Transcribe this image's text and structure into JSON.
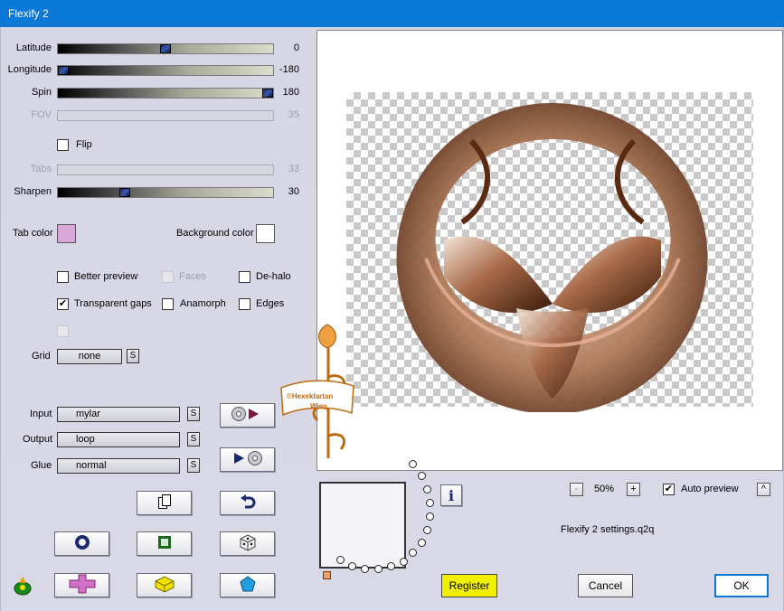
{
  "window": {
    "title": "Flexify 2"
  },
  "sliders": [
    {
      "label": "Latitude",
      "value": "0",
      "position": 0.5,
      "enabled": true
    },
    {
      "label": "Longitude",
      "value": "-180",
      "position": 0.0,
      "enabled": true
    },
    {
      "label": "Spin",
      "value": "180",
      "position": 1.0,
      "enabled": true
    },
    {
      "label": "FOV",
      "value": "35",
      "position": 0,
      "enabled": false
    },
    {
      "label": "Tabs",
      "value": "33",
      "position": 0,
      "enabled": false
    },
    {
      "label": "Sharpen",
      "value": "30",
      "position": 0.3,
      "enabled": true
    }
  ],
  "flip": {
    "label": "Flip",
    "checked": false
  },
  "colors": {
    "tab_label": "Tab color",
    "tab_value": "#d9a8d8",
    "bg_label": "Background color",
    "bg_value": "#ffffff"
  },
  "options": {
    "better_preview": {
      "label": "Better preview",
      "checked": false
    },
    "faces": {
      "label": "Faces",
      "checked": false,
      "enabled": false
    },
    "dehalo": {
      "label": "De-halo",
      "checked": false
    },
    "transparent_gaps": {
      "label": "Transparent gaps",
      "checked": true
    },
    "anamorph": {
      "label": "Anamorph",
      "checked": false
    },
    "edges": {
      "label": "Edges",
      "checked": false
    }
  },
  "grid": {
    "label": "Grid",
    "value": "none",
    "s": "S"
  },
  "projection": {
    "input_label": "Input",
    "input_value": "mylar",
    "output_label": "Output",
    "output_value": "loop",
    "glue_label": "Glue",
    "glue_value": "normal",
    "s": "S"
  },
  "zoom": {
    "minus": "-",
    "value": "50%",
    "plus": "+"
  },
  "auto_preview": {
    "label": "Auto preview",
    "checked": true,
    "toggle": "^"
  },
  "settings_file": "Flexify 2 settings.q2q",
  "info": "i",
  "buttons": {
    "register": "Register",
    "cancel": "Cancel",
    "ok": "OK"
  },
  "watermark": {
    "line1": "©Hexeklartan",
    "line2": "Wien"
  },
  "icon_colors": {
    "yellow": "#f0e000",
    "pink": "#d070c8",
    "navy": "#1a2a70",
    "green": "#1a6a1a",
    "cyan": "#20a0e0"
  }
}
